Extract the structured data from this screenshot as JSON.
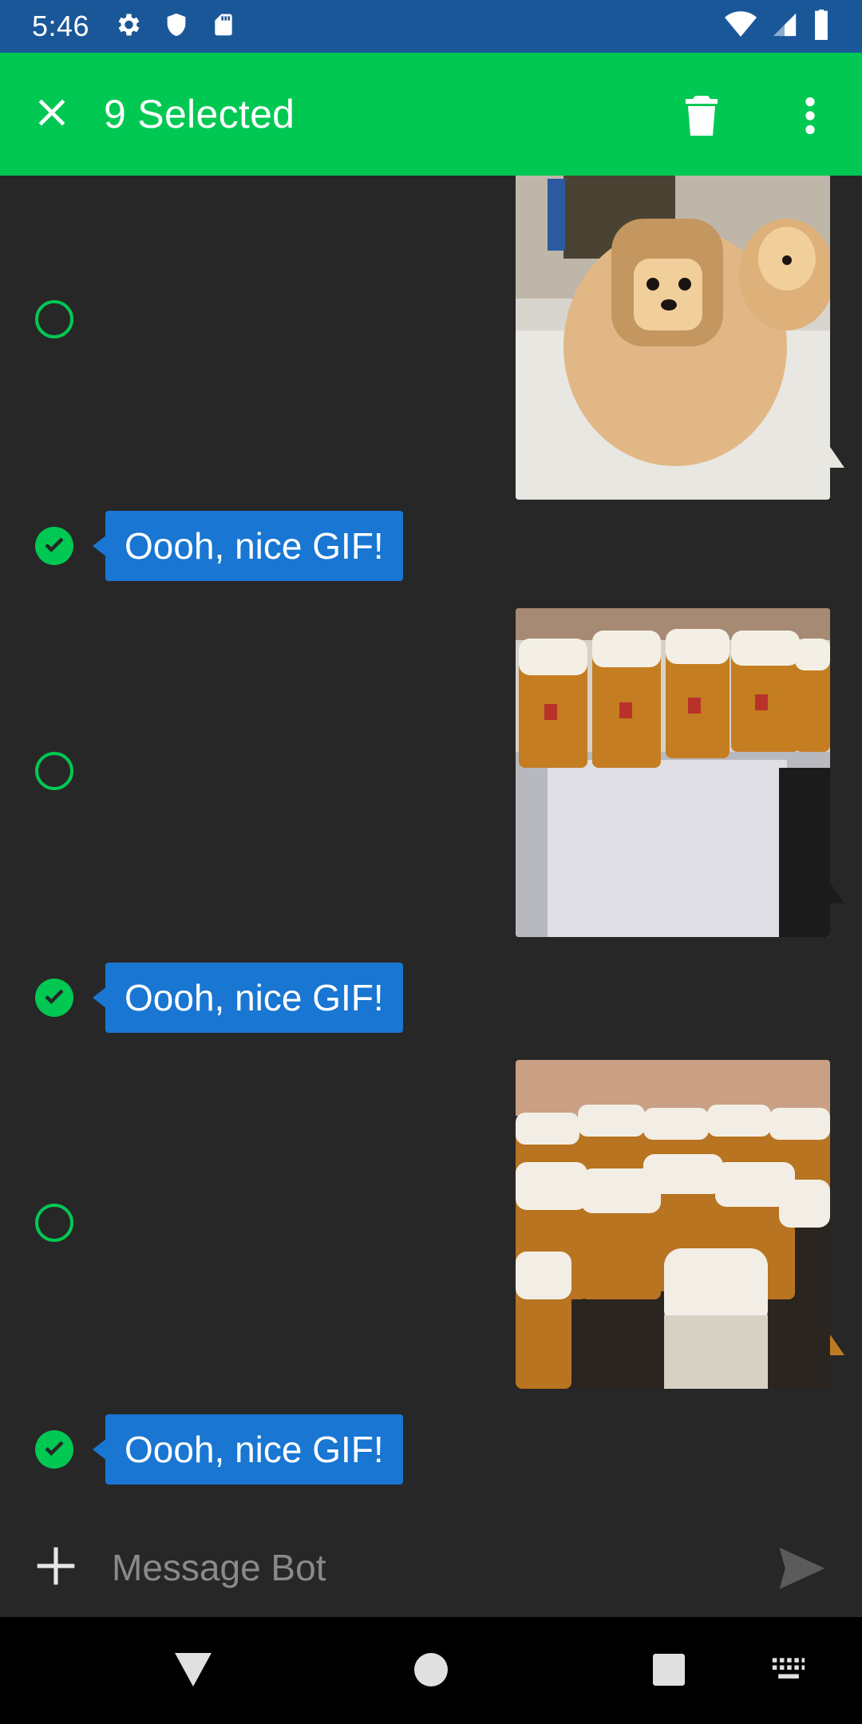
{
  "status_bar": {
    "time": "5:46",
    "left_icons": [
      "gear-icon",
      "shield-icon",
      "sd-card-icon"
    ],
    "right_icons": [
      "wifi-icon",
      "cellular-signal-icon",
      "battery-icon"
    ]
  },
  "app_bar": {
    "title": "9 Selected",
    "color": "#00c853",
    "icons": [
      "close-icon",
      "trash-icon",
      "more-vert-icon"
    ]
  },
  "messages": [
    {
      "type": "gif",
      "description": "pomeranian dog with bread",
      "selected": false
    },
    {
      "type": "text",
      "text": "Oooh, nice GIF!",
      "selected": true
    },
    {
      "type": "gif",
      "description": "waitress carrying beer steins",
      "selected": false
    },
    {
      "type": "text",
      "text": "Oooh, nice GIF!",
      "selected": true
    },
    {
      "type": "gif",
      "description": "beer steins on tray",
      "selected": false
    },
    {
      "type": "text",
      "text": "Oooh, nice GIF!",
      "selected": true
    }
  ],
  "input": {
    "placeholder": "Message Bot",
    "value": ""
  },
  "colors": {
    "accent": "#00c853",
    "bubble": "#1976d2",
    "background": "#272727",
    "status_bar": "#1a5799"
  },
  "nav_bar": {
    "icons": [
      "back-icon",
      "home-icon",
      "recents-icon",
      "keyboard-icon"
    ]
  }
}
